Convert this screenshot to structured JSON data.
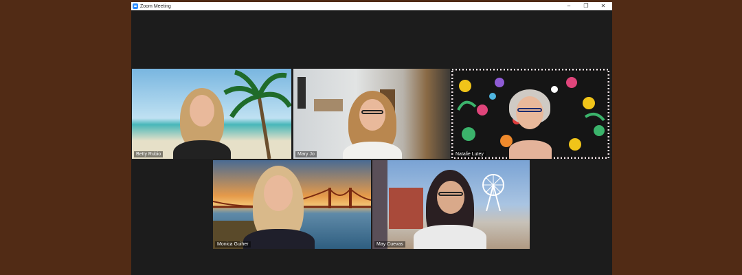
{
  "window": {
    "title": "Zoom Meeting",
    "controls": {
      "minimize": "–",
      "restore": "❐",
      "close": "✕"
    },
    "active_speaker_color": "#c8e04a"
  },
  "participants": [
    {
      "name": "Betty Rubio",
      "background": "beach-with-palm-tree"
    },
    {
      "name": "Mary Jo",
      "background": "office"
    },
    {
      "name": "Natalie Lutey",
      "background": "floral-pattern"
    },
    {
      "name": "Monica Guiher",
      "background": "golden-gate-bridge-sunset"
    },
    {
      "name": "May Cuevas",
      "background": "waterfront-with-ferris-wheel"
    }
  ]
}
